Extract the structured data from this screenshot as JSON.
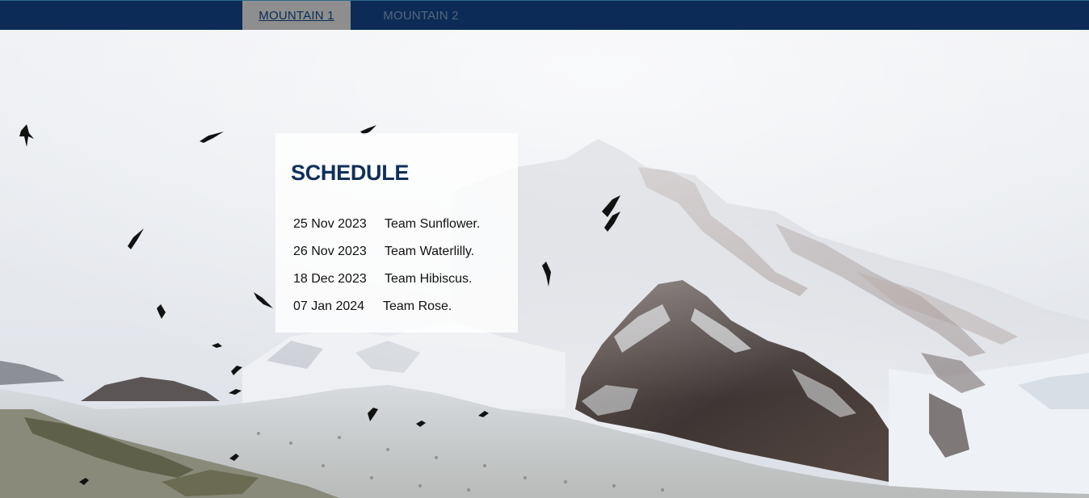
{
  "nav": {
    "tabs": [
      {
        "label": "MOUNTAIN 1",
        "active": true
      },
      {
        "label": "MOUNTAIN 2",
        "active": false
      }
    ],
    "bar_color": "#0c2c57",
    "active_tab_color": "#8e8e8e"
  },
  "schedule": {
    "title": "SCHEDULE",
    "rows": [
      {
        "date": "25 Nov 2023",
        "team": "Team Sunflower."
      },
      {
        "date": "26 Nov 2023",
        "team": "Team Waterlilly."
      },
      {
        "date": "18 Dec 2023",
        "team": "Team Hibiscus."
      },
      {
        "date": "07 Jan 2024",
        "team": "Team Rose."
      }
    ]
  },
  "background": {
    "icon": "snowy-mountain-with-birds-photo"
  }
}
